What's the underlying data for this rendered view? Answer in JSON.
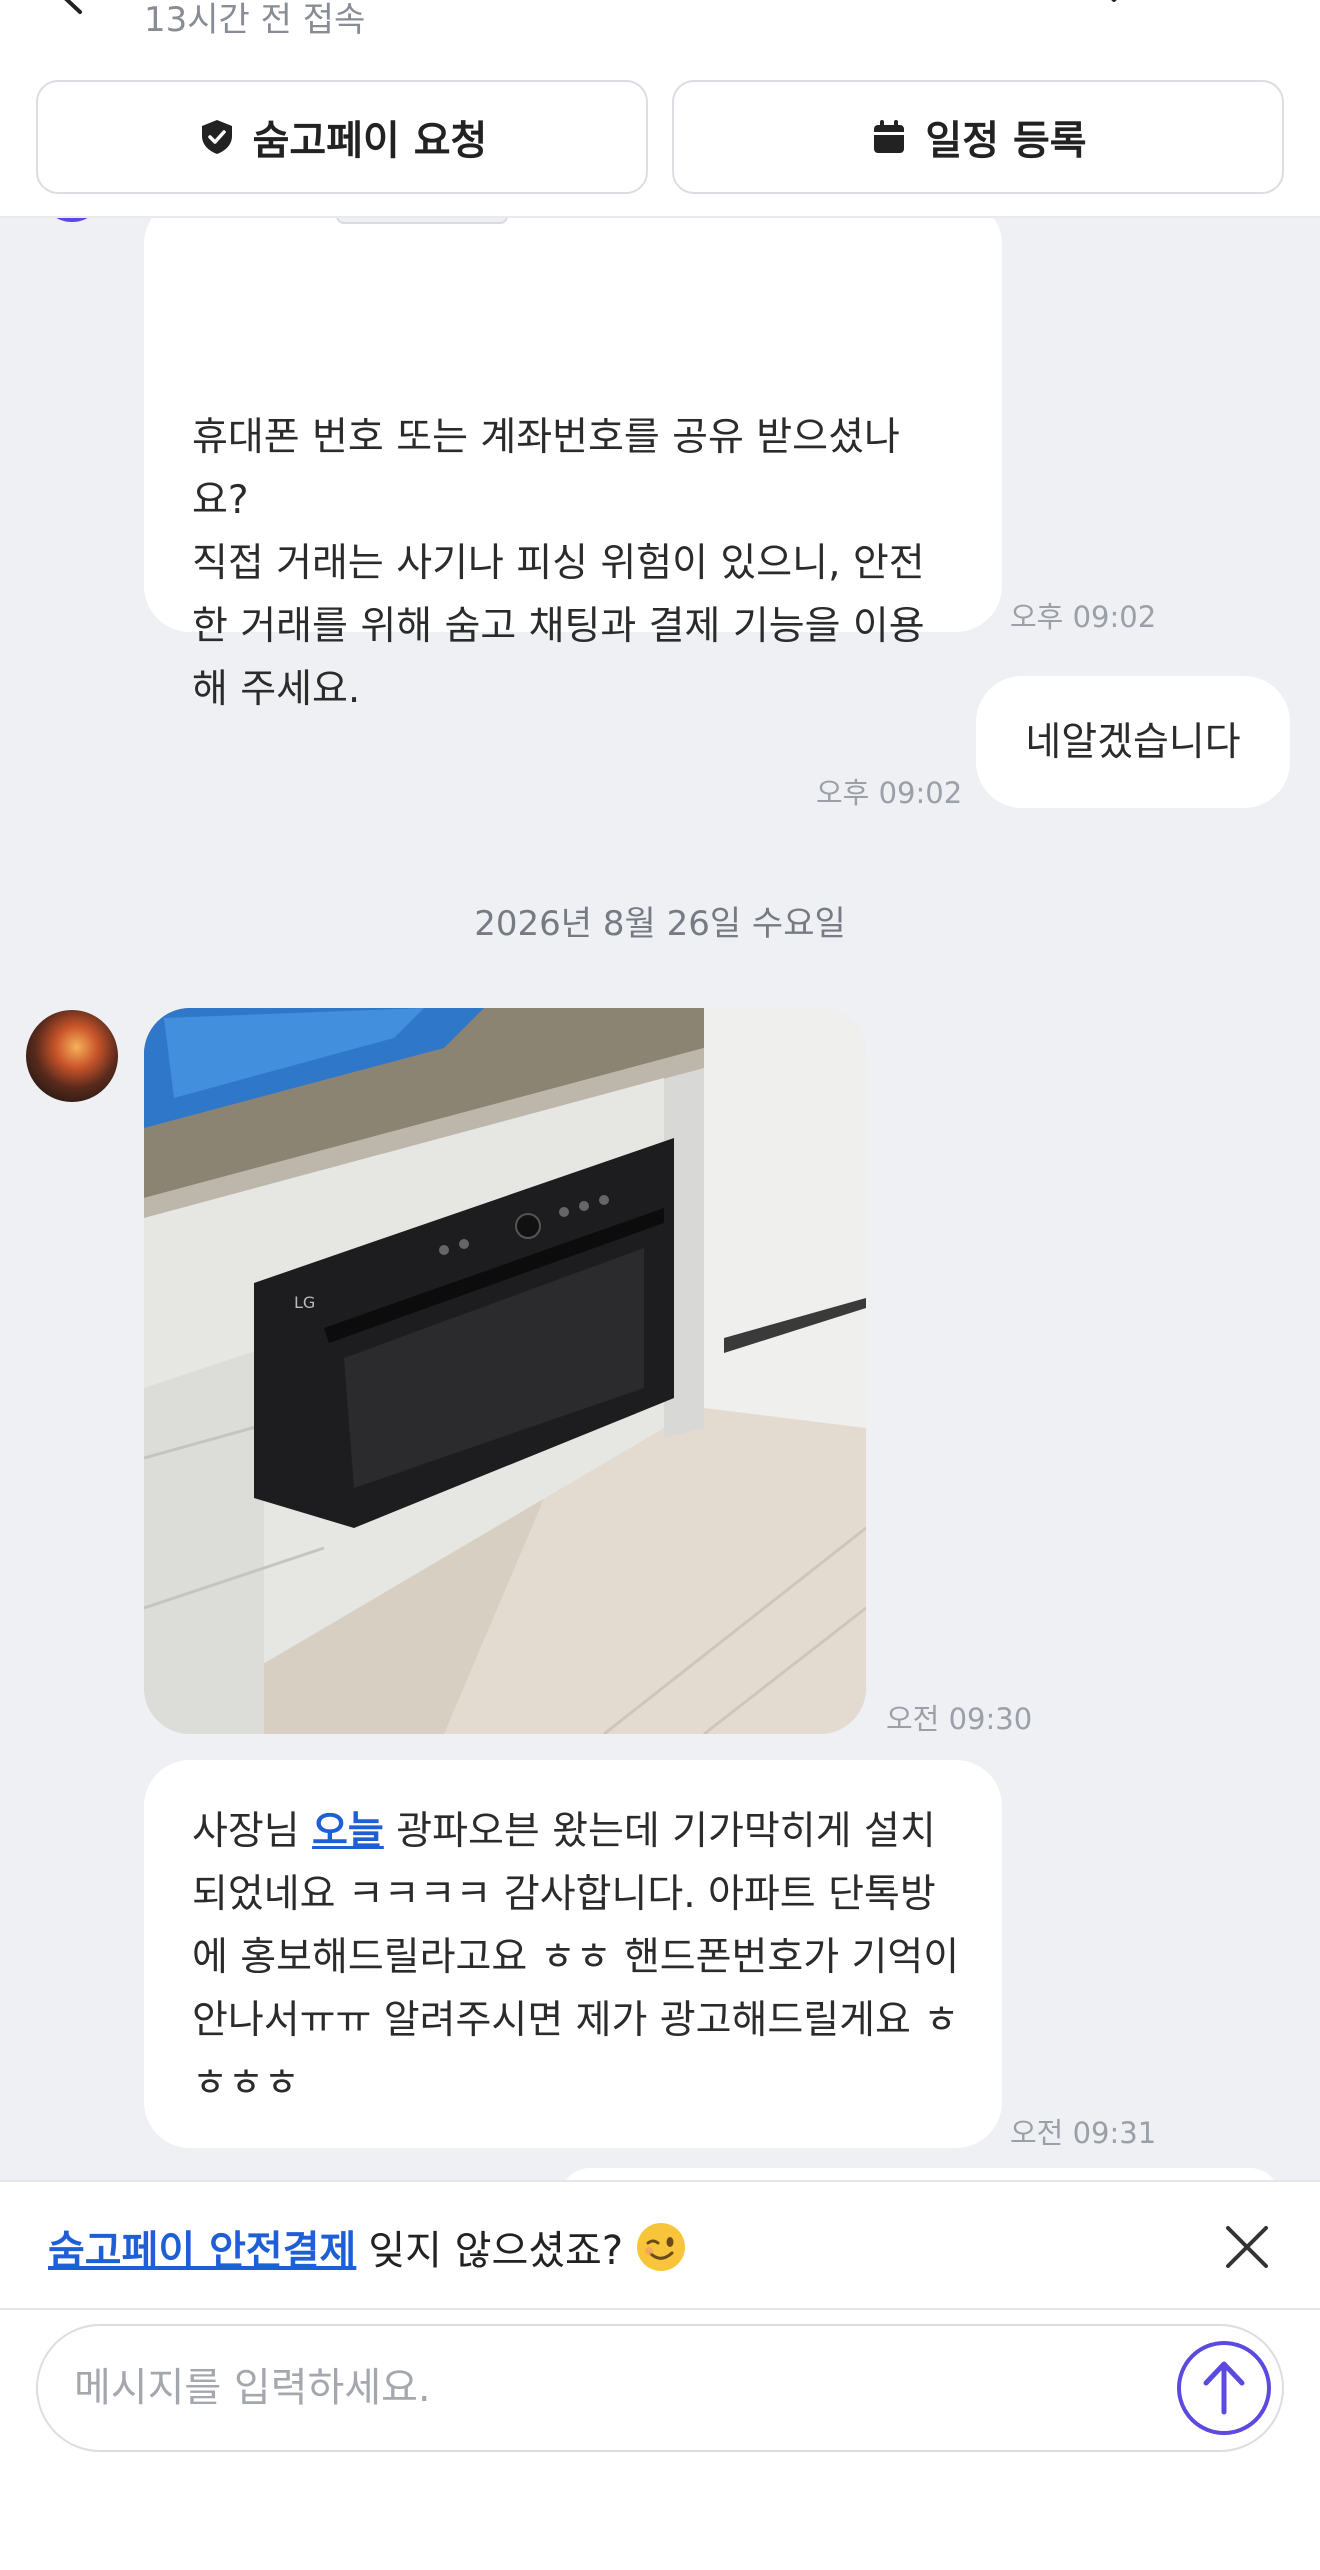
{
  "header": {
    "status": "13시간 전 접속",
    "buttons": {
      "pay_request": "숨고페이 요청",
      "schedule": "일정 등록"
    },
    "icons": [
      "back-arrow-icon",
      "heart-icon",
      "bookmark-icon",
      "more-icon"
    ]
  },
  "messages": [
    {
      "side": "received",
      "text": "휴대폰 번호 또는 계좌번호를 공유 받으셨나\n요?\n직접 거래는 사기나 피싱 위험이 있으니, 안전\n한 거래를 위해 숨고 채팅과 결제 기능을 이용\n해 주세요.",
      "time": "오후 09:02"
    },
    {
      "side": "sent",
      "text": "네알겠습니다",
      "time": "오후 09:02"
    }
  ],
  "date_separator": "2026년 8월 26일 수요일",
  "messages_day2": [
    {
      "side": "received",
      "type": "image",
      "time": "오전 09:30"
    },
    {
      "side": "received",
      "text_before": "사장님 ",
      "link": "오늘",
      "text_after": " 광파오븐 왔는데 기가막히게 설치되었네요 ㅋㅋㅋㅋ 감사합니다. 아파트 단톡방에 홍보해드릴라고요 ㅎㅎ 핸드폰번호가 기억이 안나서ㅠㅠ 알려주시면 제가 광고해드릴게요 ㅎㅎㅎㅎ",
      "time": "오전 09:31"
    }
  ],
  "banner": {
    "link": "숨고페이 안전결제",
    "text": "잊지 않으셨죠?"
  },
  "input": {
    "placeholder": "메시지를 입력하세요."
  },
  "colors": {
    "accent": "#5b49e0",
    "link": "#1f5fd6",
    "background": "#eff0f4"
  }
}
